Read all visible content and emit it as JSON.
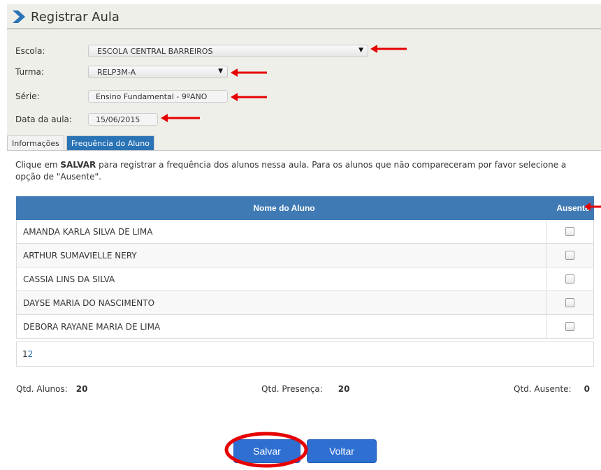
{
  "header": {
    "title": "Registrar Aula"
  },
  "form": {
    "escola": {
      "label": "Escola:",
      "value": "ESCOLA CENTRAL BARREIROS"
    },
    "turma": {
      "label": "Turma:",
      "value": "RELP3M-A"
    },
    "serie": {
      "label": "Série:",
      "value": "Ensino Fundamental - 9ºANO"
    },
    "data": {
      "label": "Data da aula:",
      "value": "15/06/2015"
    }
  },
  "tabs": [
    {
      "label": "Informações",
      "active": false
    },
    {
      "label": "Frequência do Aluno",
      "active": true
    }
  ],
  "instruction": {
    "prefix": "Clique em ",
    "bold": "SALVAR",
    "suffix": " para registrar a frequência dos alunos nessa aula. Para os alunos que não compareceram por favor selecione a opção de \"Ausente\"."
  },
  "table": {
    "columns": [
      "Nome do Aluno",
      "Ausente"
    ],
    "rows": [
      {
        "name": "AMANDA KARLA SILVA DE LIMA",
        "absent": false
      },
      {
        "name": "ARTHUR SUMAVIELLE NERY",
        "absent": false
      },
      {
        "name": "CASSIA LINS DA SILVA",
        "absent": false
      },
      {
        "name": "DAYSE MARIA DO NASCIMENTO",
        "absent": false
      },
      {
        "name": "DEBORA RAYANE MARIA DE LIMA",
        "absent": false
      }
    ]
  },
  "pager": {
    "current": "1",
    "next": "2"
  },
  "totals": {
    "alunos_label": "Qtd. Alunos:",
    "alunos": "20",
    "presenca_label": "Qtd. Presença:",
    "presenca": "20",
    "ausente_label": "Qtd. Ausente:",
    "ausente": "0"
  },
  "buttons": {
    "save": "Salvar",
    "back": "Voltar"
  },
  "colors": {
    "accent": "#2a73b5",
    "grid_header": "#3f7ab4",
    "annotation": "#e60000",
    "button": "#2e6fd1"
  },
  "icons": {
    "title": "chevron-right-icon",
    "annotations": "red-arrow-icon",
    "highlight": "red-ellipse"
  }
}
